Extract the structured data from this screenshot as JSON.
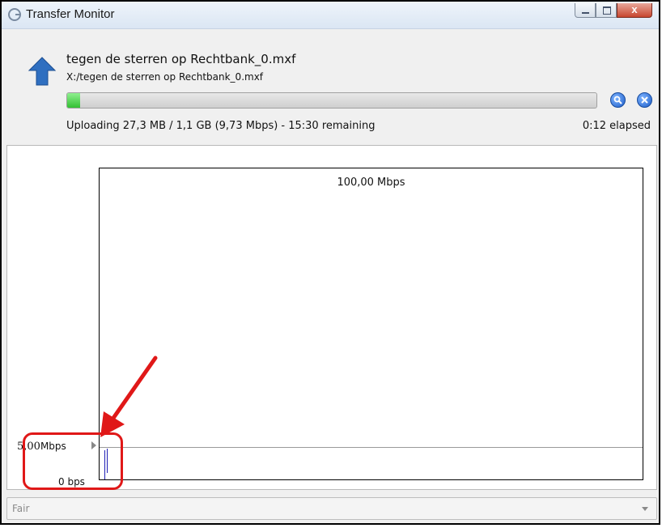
{
  "window": {
    "title": "Transfer Monitor",
    "controls": {
      "close_glyph": "x"
    }
  },
  "transfer": {
    "direction_icon": "upload-arrow-icon",
    "file_name": "tegen de sterren op Rechtbank_0.mxf",
    "file_path": "X:/tegen de sterren op Rechtbank_0.mxf",
    "progress_fraction": 0.025,
    "status": "Uploading 27,3 MB / 1,1 GB (9,73 Mbps) - 15:30 remaining",
    "elapsed": "0:12 elapsed",
    "colors": {
      "progress_fill": "#33c033",
      "action_button": "#1c5dc9"
    }
  },
  "graph": {
    "max_label": "100,00 Mbps",
    "threshold_value": "5,00",
    "threshold_unit": "Mbps",
    "min_label": "0 bps",
    "colors": {
      "trace": "#1f1fb5",
      "annotation": "#e01818"
    }
  },
  "quality_select": {
    "value": "Fair"
  }
}
